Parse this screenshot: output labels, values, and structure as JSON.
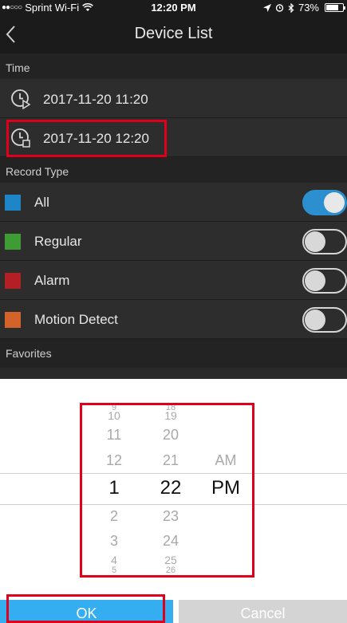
{
  "status_bar": {
    "carrier": "Sprint Wi-Fi",
    "time": "12:20 PM",
    "battery": "73%",
    "battery_level": 0.73
  },
  "nav": {
    "title": "Device List",
    "back_icon": "chevron-left-icon"
  },
  "sections": {
    "time": "Time",
    "record_type": "Record Type",
    "favorites": "Favorites"
  },
  "time_rows": [
    {
      "icon": "clock-play-icon",
      "value": "2017-11-20 11:20"
    },
    {
      "icon": "clock-stop-icon",
      "value": "2017-11-20 12:20"
    }
  ],
  "record_types": [
    {
      "label": "All",
      "color": "#1f86c6",
      "enabled": true
    },
    {
      "label": "Regular",
      "color": "#3f9c35",
      "enabled": false
    },
    {
      "label": "Alarm",
      "color": "#b21f24",
      "enabled": false
    },
    {
      "label": "Motion Detect",
      "color": "#d4632a",
      "enabled": false
    }
  ],
  "picker": {
    "hours": [
      "9",
      "10",
      "11",
      "12",
      "1",
      "2",
      "3",
      "4",
      "5"
    ],
    "minutes": [
      "18",
      "19",
      "20",
      "21",
      "22",
      "23",
      "24",
      "25",
      "26"
    ],
    "ampm": [
      "AM",
      "PM"
    ],
    "selected": {
      "hour": "1",
      "minute": "22",
      "ampm": "PM"
    }
  },
  "buttons": {
    "ok": "OK",
    "cancel": "Cancel"
  }
}
